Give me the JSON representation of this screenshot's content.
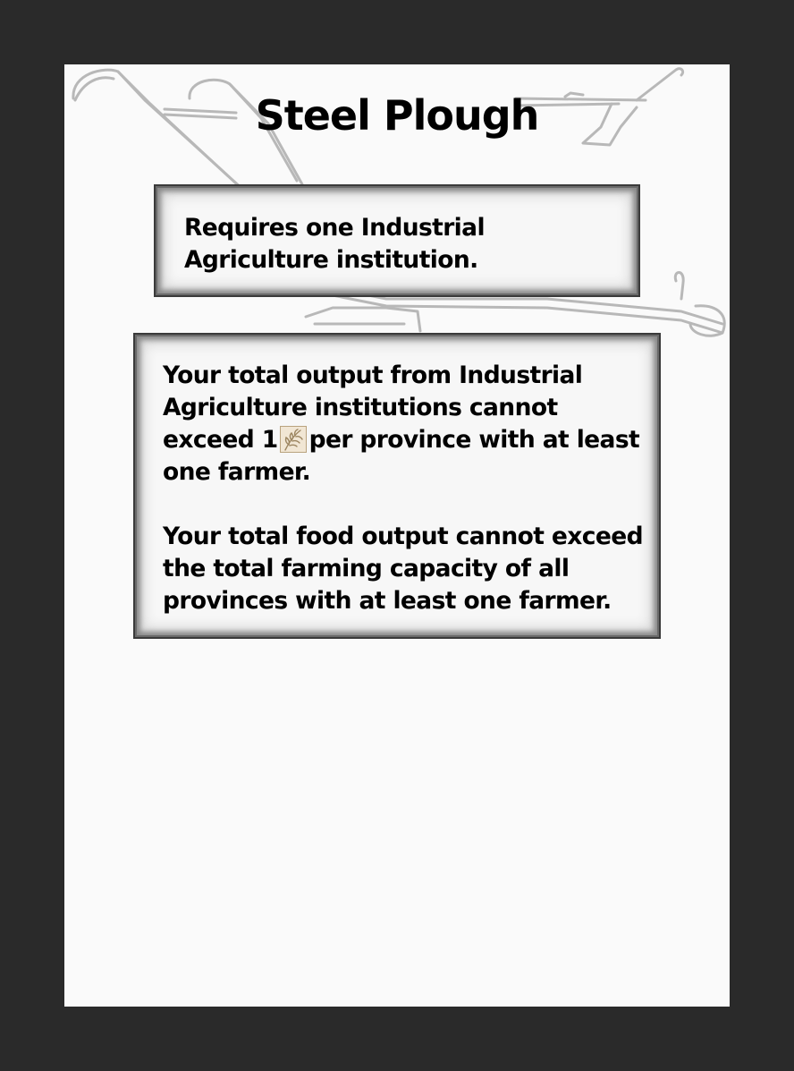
{
  "card": {
    "title": "Steel Plough",
    "requirement_text": "Requires one Industrial Agriculture institution.",
    "effect": {
      "line1_prefix": "Your total output from Industrial Agriculture institutions cannot exceed",
      "amount": "1",
      "icon": "wheat-food-icon",
      "line1_suffix": "per province with at least one farmer.",
      "line2": "Your total food output cannot exceed the total farming capacity of all provinces with at least one farmer."
    }
  },
  "colors": {
    "background": "#2a2a2a",
    "card": "#fafafa",
    "box_border": "#3a3a3a",
    "text": "#000000"
  }
}
